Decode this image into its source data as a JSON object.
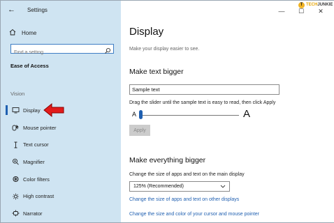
{
  "window": {
    "app_title": "Settings",
    "controls": {
      "minimize": "—",
      "maximize": "☐",
      "close": "✕"
    },
    "watermark": {
      "dot": "T",
      "text_prefix": "TECH",
      "text_suffix": "JUNKIE"
    }
  },
  "sidebar": {
    "home_label": "Home",
    "search": {
      "placeholder": "Find a setting",
      "value": ""
    },
    "section_title": "Ease of Access",
    "group_label": "Vision",
    "items": [
      {
        "label": "Display",
        "icon": "monitor-icon",
        "active": true
      },
      {
        "label": "Mouse pointer",
        "icon": "mouse-pointer-icon",
        "active": false
      },
      {
        "label": "Text cursor",
        "icon": "text-cursor-icon",
        "active": false
      },
      {
        "label": "Magnifier",
        "icon": "magnifier-icon",
        "active": false
      },
      {
        "label": "Color filters",
        "icon": "color-filters-icon",
        "active": false
      },
      {
        "label": "High contrast",
        "icon": "high-contrast-icon",
        "active": false
      },
      {
        "label": "Narrator",
        "icon": "narrator-icon",
        "active": false
      }
    ]
  },
  "main": {
    "title": "Display",
    "subtitle": "Make your display easier to see.",
    "text_bigger": {
      "heading": "Make text bigger",
      "sample_value": "Sample text",
      "instruction": "Drag the slider until the sample text is easy to read, then click Apply",
      "small_a": "A",
      "big_a": "A",
      "slider_percent": 0,
      "apply_label": "Apply"
    },
    "everything_bigger": {
      "heading": "Make everything bigger",
      "size_label": "Change the size of apps and text on the main display",
      "dropdown_value": "125% (Recommended)",
      "link_other_displays": "Change the size of apps and text on other displays",
      "link_cursor": "Change the size and color of your cursor and mouse pointer"
    }
  },
  "colors": {
    "sidebar_bg": "#cfe4f2",
    "accent": "#1f5fb0",
    "annotation_arrow": "#e21b1b"
  }
}
